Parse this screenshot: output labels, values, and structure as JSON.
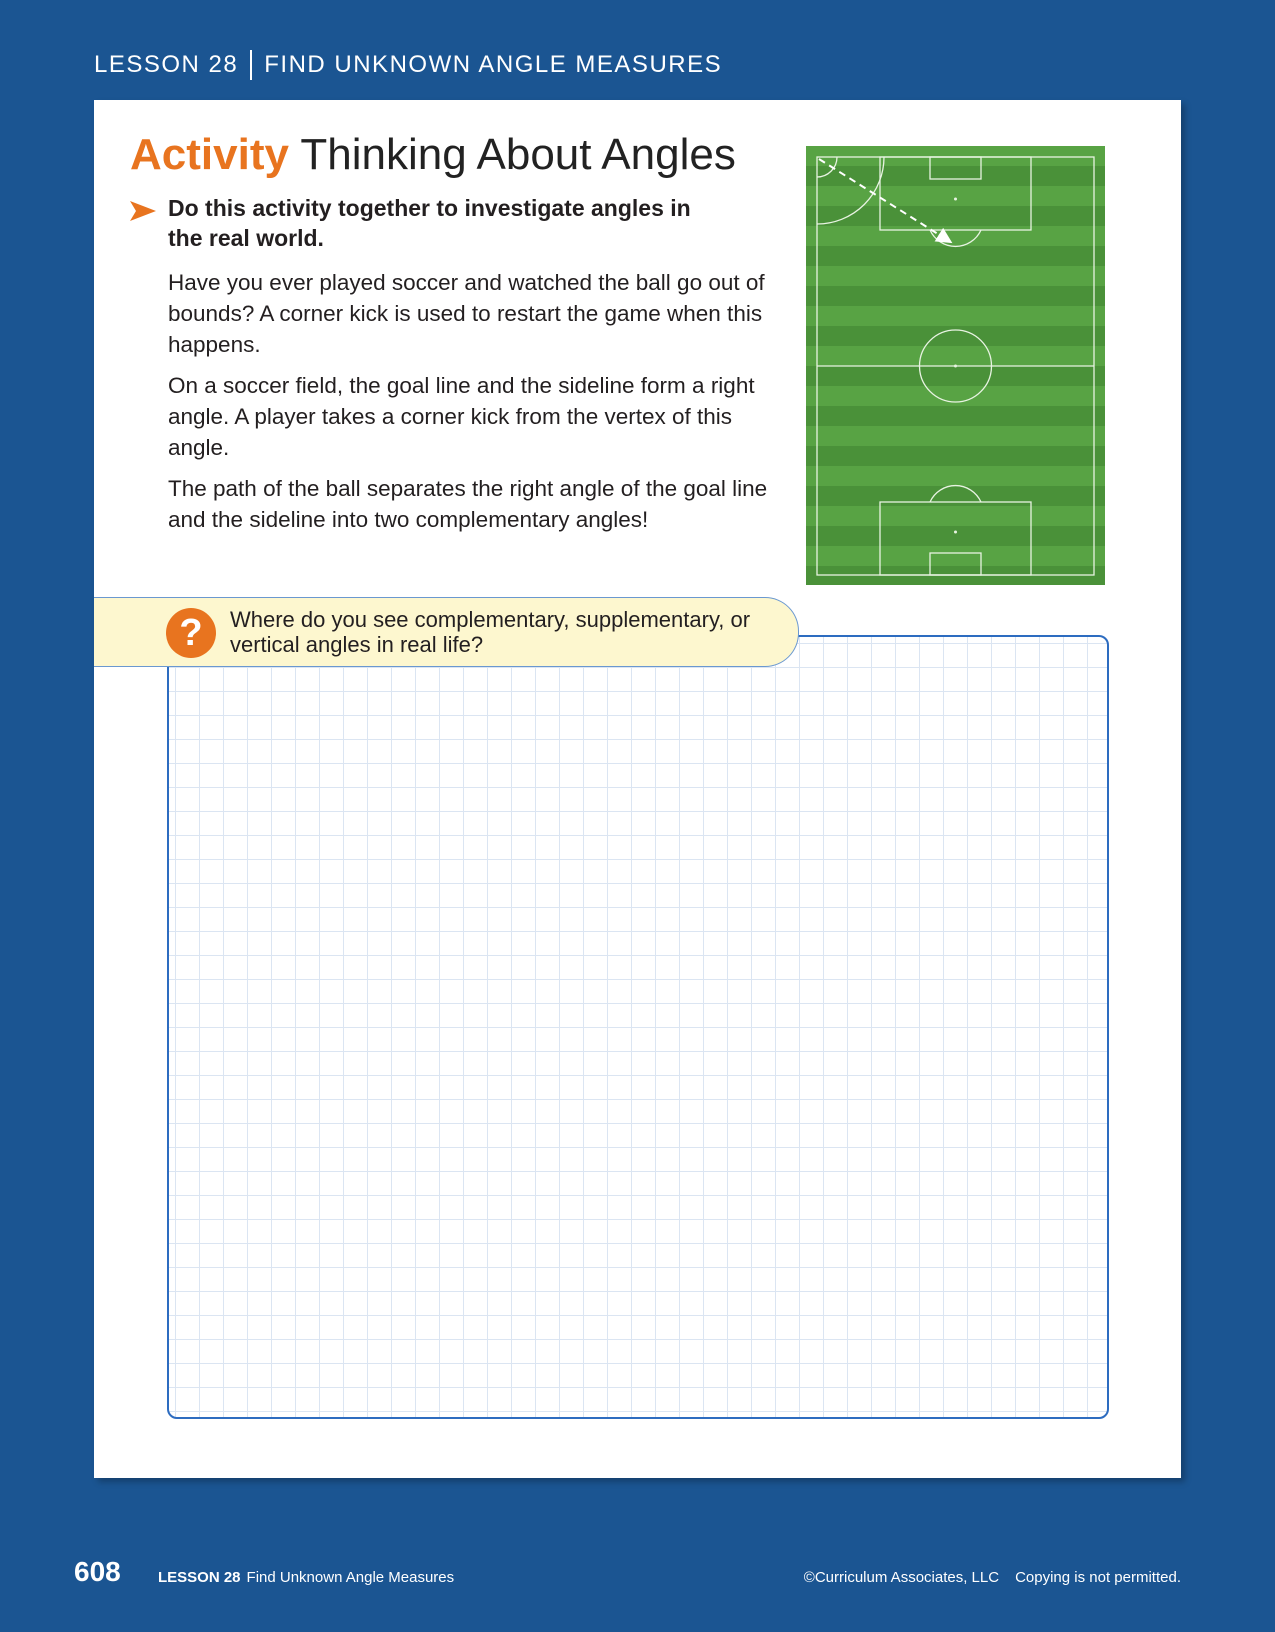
{
  "header": {
    "lesson": "LESSON 28",
    "topic": "FIND UNKNOWN ANGLE MEASURES"
  },
  "activity": {
    "title_accent": "Activity",
    "title_rest": "Thinking About Angles",
    "lead": "Do this activity together to investigate angles in the real world.",
    "paragraphs": [
      "Have you ever played soccer and watched the ball go out of bounds? A corner kick is used to restart the game when this happens.",
      "On a soccer field, the goal line and the sideline form a right angle. A player takes a corner kick from the vertex of this angle.",
      "The path of the ball separates the right angle of the goal line and the sideline into two complementary angles!"
    ]
  },
  "question": {
    "icon": "?",
    "text": "Where do you see complementary, supplementary, or vertical angles in real life?"
  },
  "footer": {
    "page_number": "608",
    "lesson": "LESSON 28",
    "lesson_title": "Find Unknown Angle Measures",
    "copyright": "©Curriculum Associates, LLC",
    "notice": "Copying is not permitted."
  },
  "colors": {
    "background": "#1b5592",
    "accent_orange": "#e8741f",
    "grass_green": "#4e9a3b",
    "question_bg": "#fdf7cf",
    "grid_border": "#2d6cc0"
  },
  "icons": [
    "arrow-bullet-icon",
    "question-mark-icon"
  ]
}
